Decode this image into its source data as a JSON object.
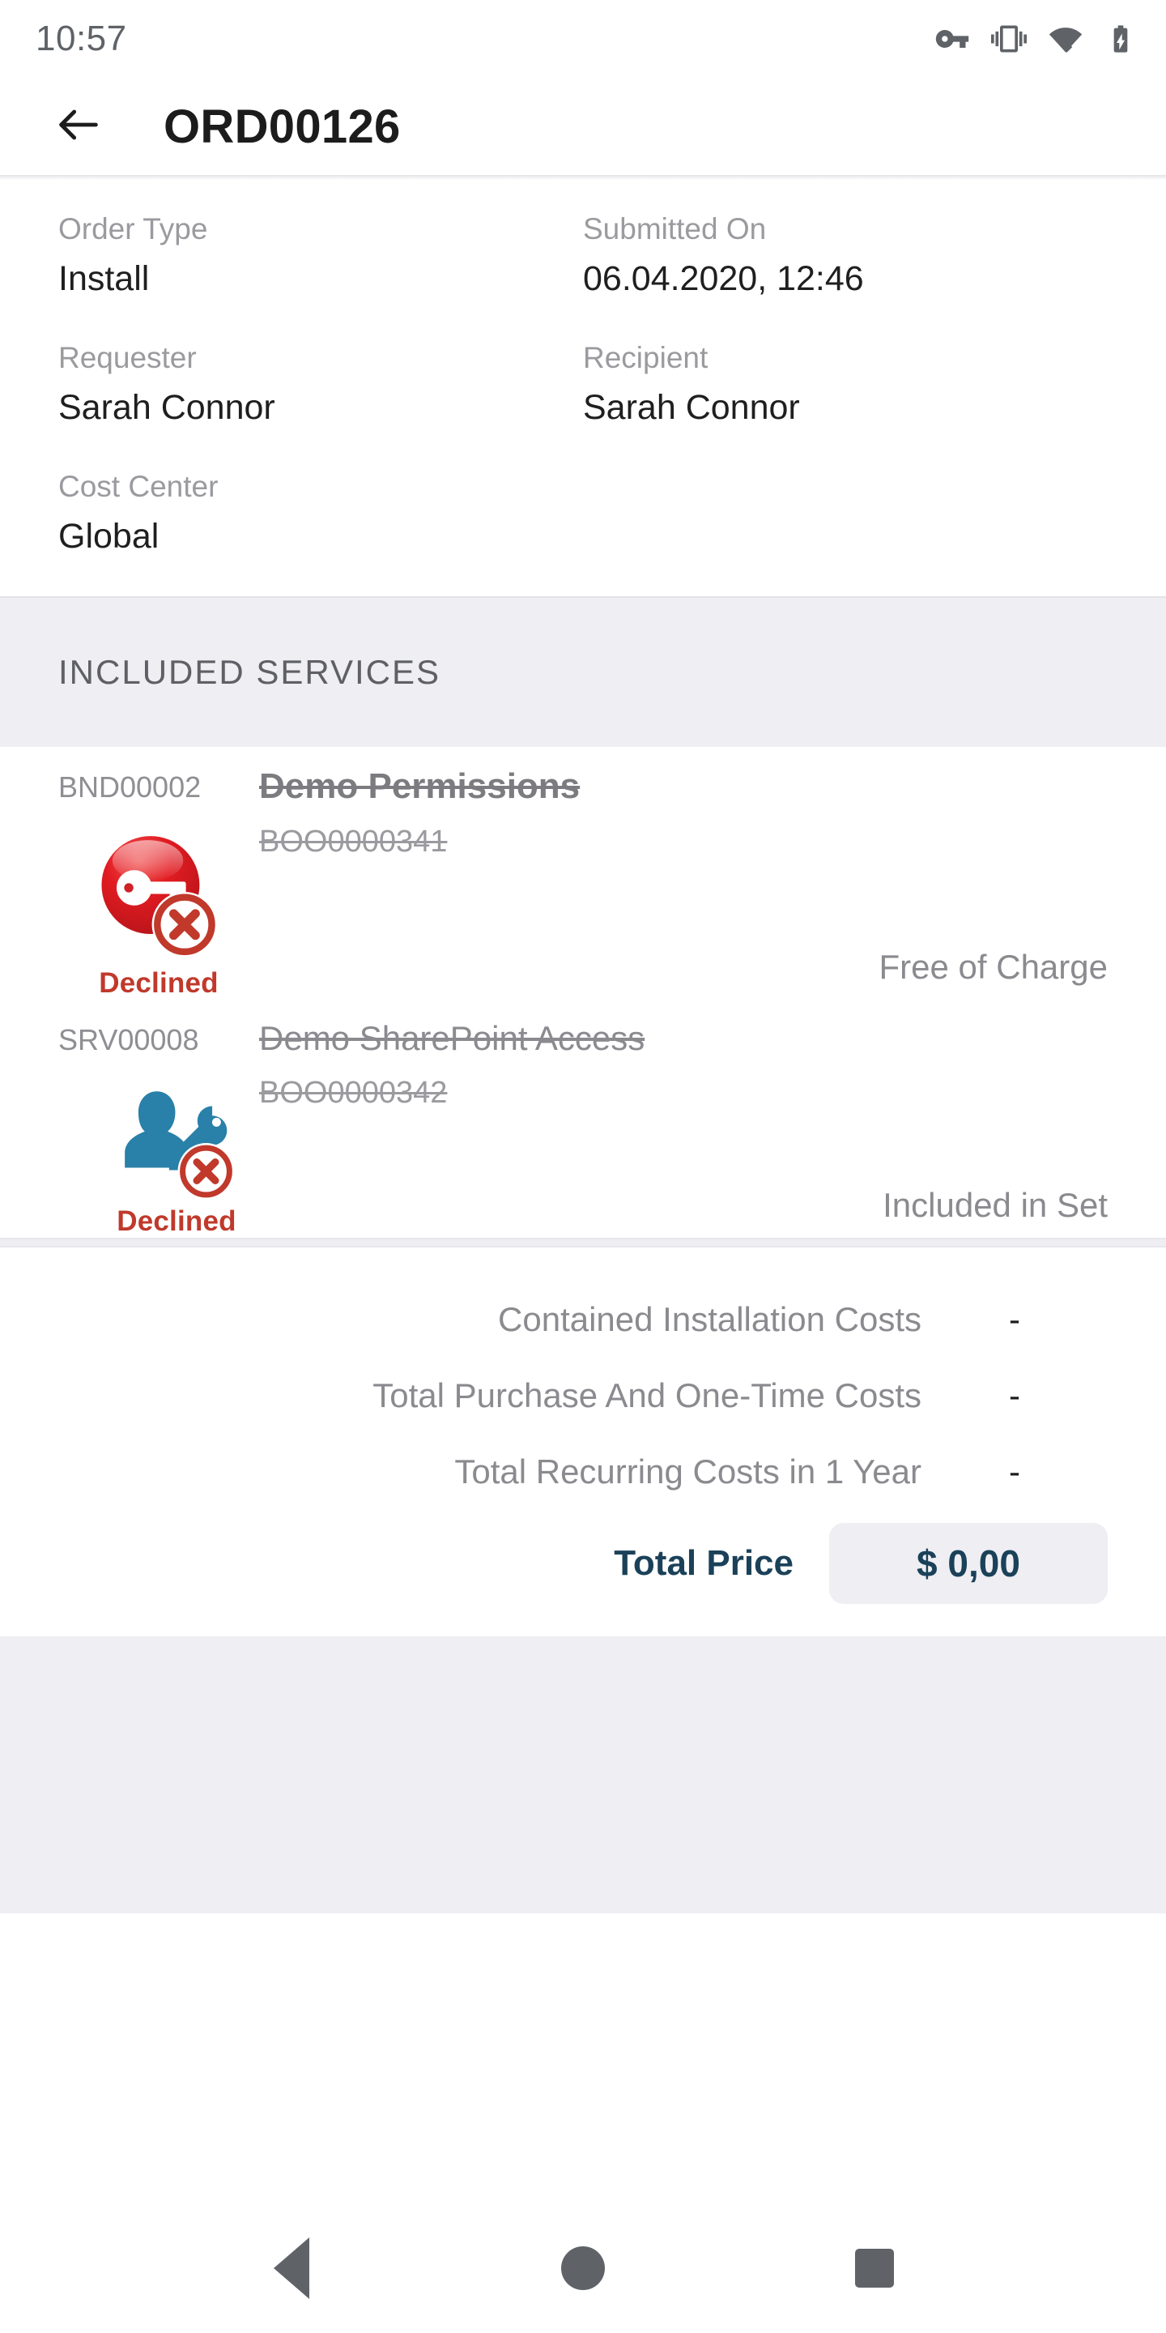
{
  "statusbar": {
    "time": "10:57",
    "icons": [
      "vpn-key-icon",
      "vibrate-icon",
      "wifi-icon",
      "battery-charging-icon"
    ]
  },
  "appbar": {
    "back_icon": "arrow-back-icon",
    "title": "ORD00126"
  },
  "details": [
    [
      {
        "label": "Order Type",
        "value": "Install"
      },
      {
        "label": "Submitted On",
        "value": "06.04.2020, 12:46"
      }
    ],
    [
      {
        "label": "Requester",
        "value": "Sarah Connor"
      },
      {
        "label": "Recipient",
        "value": "Sarah Connor"
      }
    ],
    [
      {
        "label": "Cost Center",
        "value": "Global"
      },
      {
        "label": "",
        "value": ""
      }
    ]
  ],
  "services_section": {
    "header": "INCLUDED SERVICES",
    "items": [
      {
        "id": "BND00002",
        "name": "Demo Permissions",
        "booking": "BOO0000341",
        "status": "Declined",
        "price": "Free of Charge",
        "icon": "red-key-declined-icon"
      },
      {
        "id": "SRV00008",
        "name": "Demo SharePoint Access",
        "booking": "BOO0000342",
        "status": "Declined",
        "price": "Included in Set",
        "icon": "blue-user-key-declined-icon"
      }
    ]
  },
  "costs": {
    "rows": [
      {
        "label": "Contained Installation Costs",
        "value": "-"
      },
      {
        "label": "Total Purchase And One-Time Costs",
        "value": "-"
      },
      {
        "label": "Total Recurring Costs in 1 Year",
        "value": "-"
      }
    ],
    "total_label": "Total Price",
    "total_value": "$ 0,00"
  },
  "navbar": {
    "back": "nav-back-icon",
    "home": "nav-home-icon",
    "recents": "nav-recents-icon"
  },
  "colors": {
    "accent_navy": "#1b4159",
    "declined_red": "#c0392b",
    "icon_blue": "#2980a8",
    "section_bg": "#eeeef3",
    "muted_text": "#8a8a8f"
  }
}
